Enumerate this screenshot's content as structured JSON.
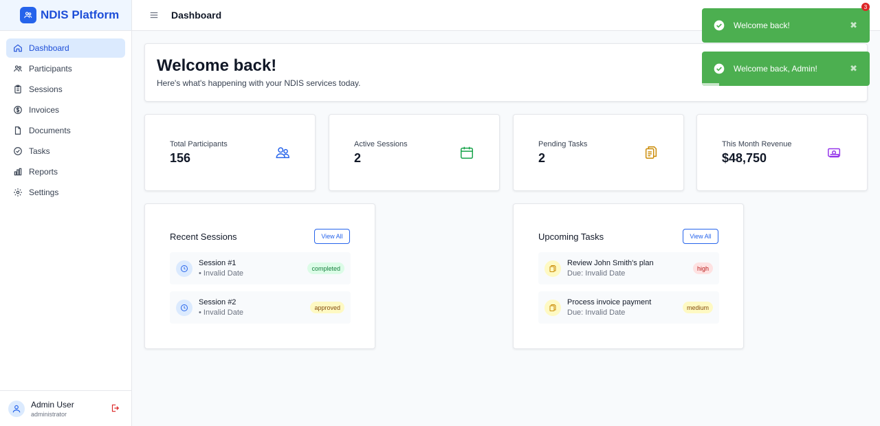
{
  "brand": {
    "title": "NDIS Platform"
  },
  "sidebar": {
    "items": [
      {
        "label": "Dashboard",
        "icon": "home-icon",
        "active": true
      },
      {
        "label": "Participants",
        "icon": "users-icon"
      },
      {
        "label": "Sessions",
        "icon": "clipboard-icon"
      },
      {
        "label": "Invoices",
        "icon": "dollar-icon"
      },
      {
        "label": "Documents",
        "icon": "file-icon"
      },
      {
        "label": "Tasks",
        "icon": "check-circle-icon"
      },
      {
        "label": "Reports",
        "icon": "bar-chart-icon"
      },
      {
        "label": "Settings",
        "icon": "gear-icon"
      }
    ]
  },
  "user": {
    "name": "Admin User",
    "role": "administrator"
  },
  "header": {
    "title": "Dashboard",
    "notification_count": "3"
  },
  "toasts": [
    {
      "message": "Welcome back!",
      "close": "✖"
    },
    {
      "message": "Welcome back, Admin!",
      "close": "✖"
    }
  ],
  "welcome": {
    "heading": "Welcome back!",
    "subtitle": "Here's what's happening with your NDIS services today."
  },
  "stats": [
    {
      "label": "Total Participants",
      "value": "156",
      "icon": "users-icon",
      "color": "#2563eb"
    },
    {
      "label": "Active Sessions",
      "value": "2",
      "icon": "calendar-icon",
      "color": "#16a34a"
    },
    {
      "label": "Pending Tasks",
      "value": "2",
      "icon": "clipboard-icon",
      "color": "#ca8a04"
    },
    {
      "label": "This Month Revenue",
      "value": "$48,750",
      "icon": "money-icon",
      "color": "#9333ea"
    }
  ],
  "recent_sessions": {
    "title": "Recent Sessions",
    "view_all": "View All",
    "items": [
      {
        "title": "Session #1",
        "subtitle": "• Invalid Date",
        "status": "completed"
      },
      {
        "title": "Session #2",
        "subtitle": "• Invalid Date",
        "status": "approved"
      }
    ]
  },
  "upcoming_tasks": {
    "title": "Upcoming Tasks",
    "view_all": "View All",
    "items": [
      {
        "title": "Review John Smith's plan",
        "subtitle": "Due: Invalid Date",
        "priority": "high"
      },
      {
        "title": "Process invoice payment",
        "subtitle": "Due: Invalid Date",
        "priority": "medium"
      }
    ]
  },
  "colors": {
    "accent": "#2563eb",
    "toast": "#4caf50",
    "danger": "#dc2626"
  }
}
